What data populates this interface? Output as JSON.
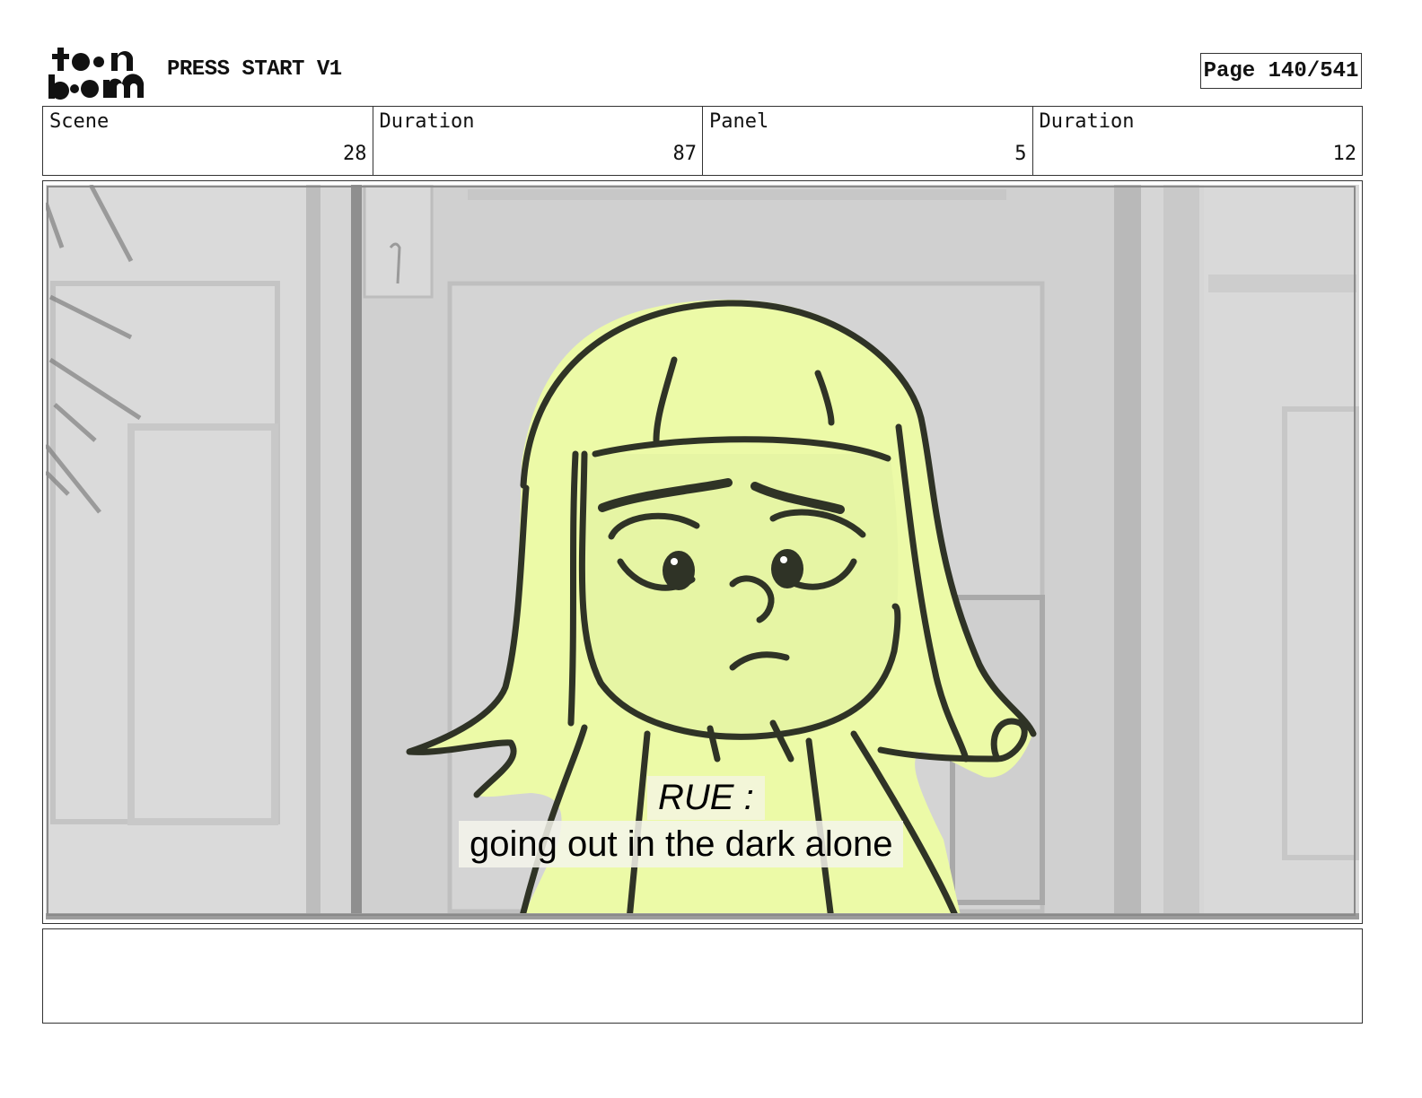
{
  "header": {
    "logo_text": "toon boom",
    "title": "PRESS START V1",
    "page": "Page 140/541"
  },
  "info": [
    {
      "label": "Scene",
      "value": "28"
    },
    {
      "label": "Duration",
      "value": "87"
    },
    {
      "label": "Panel",
      "value": "5"
    },
    {
      "label": "Duration",
      "value": "12"
    }
  ],
  "panel": {
    "speaker": "RUE :",
    "dialogue": "going out in the dark alone"
  },
  "colors": {
    "character_fill": "#eaf8a8",
    "outline": "#2f3326",
    "background_wall": "#d8d8d8"
  },
  "notes": ""
}
